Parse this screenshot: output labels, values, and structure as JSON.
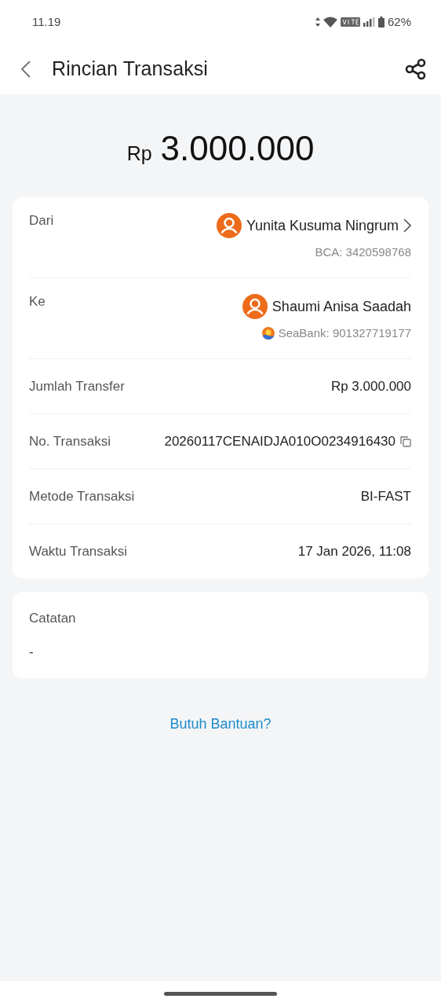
{
  "status_bar": {
    "time": "11.19",
    "battery": "62%"
  },
  "header": {
    "title": "Rincian Transaksi"
  },
  "amount": {
    "currency": "Rp",
    "value": "3.000.000"
  },
  "details": [
    {
      "kind": "party",
      "label": "Dari",
      "name": "Yunita Kusuma Ningrum",
      "account": "BCA: 3420598768",
      "bank_icon": false,
      "chevron": true
    },
    {
      "kind": "party",
      "label": "Ke",
      "name": "Shaumi Anisa Saadah",
      "account": "SeaBank: 901327719177",
      "bank_icon": true,
      "chevron": false
    },
    {
      "kind": "value",
      "label": "Jumlah Transfer",
      "value": "Rp 3.000.000",
      "copyable": false
    },
    {
      "kind": "value",
      "label": "No. Transaksi",
      "value": "20260117CENAIDJA010O0234916430",
      "copyable": true
    },
    {
      "kind": "value",
      "label": "Metode Transaksi",
      "value": "BI-FAST",
      "copyable": false
    },
    {
      "kind": "value",
      "label": "Waktu Transaksi",
      "value": "17 Jan 2026, 11:08",
      "copyable": false
    }
  ],
  "note": {
    "label": "Catatan",
    "value": "-"
  },
  "help_link": "Butuh Bantuan?"
}
